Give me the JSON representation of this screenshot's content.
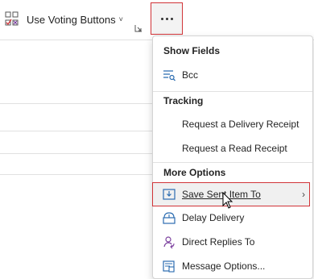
{
  "ribbon": {
    "voting_label": "Use Voting Buttons",
    "voting_chevron": "˅",
    "more_button_label": "More commands"
  },
  "menu": {
    "show_fields": {
      "header": "Show Fields",
      "items": [
        {
          "label": "Bcc",
          "icon": "bcc-icon"
        }
      ]
    },
    "tracking": {
      "header": "Tracking",
      "items": [
        {
          "label": "Request a Delivery Receipt"
        },
        {
          "label": "Request a Read Receipt"
        }
      ]
    },
    "more_options": {
      "header": "More Options",
      "items": [
        {
          "label": "Save Sent Item To",
          "icon": "save-sent-item-icon",
          "has_submenu": true,
          "submenu_arrow": "›",
          "highlighted": true
        },
        {
          "label": "Delay Delivery",
          "icon": "delay-delivery-icon"
        },
        {
          "label": "Direct Replies To",
          "icon": "direct-replies-icon"
        },
        {
          "label": "Message Options...",
          "icon": "message-options-icon"
        }
      ]
    }
  },
  "colors": {
    "highlight_border": "#d13438",
    "icon_blue": "#2b6cb0",
    "icon_purple": "#7a3e9d"
  }
}
